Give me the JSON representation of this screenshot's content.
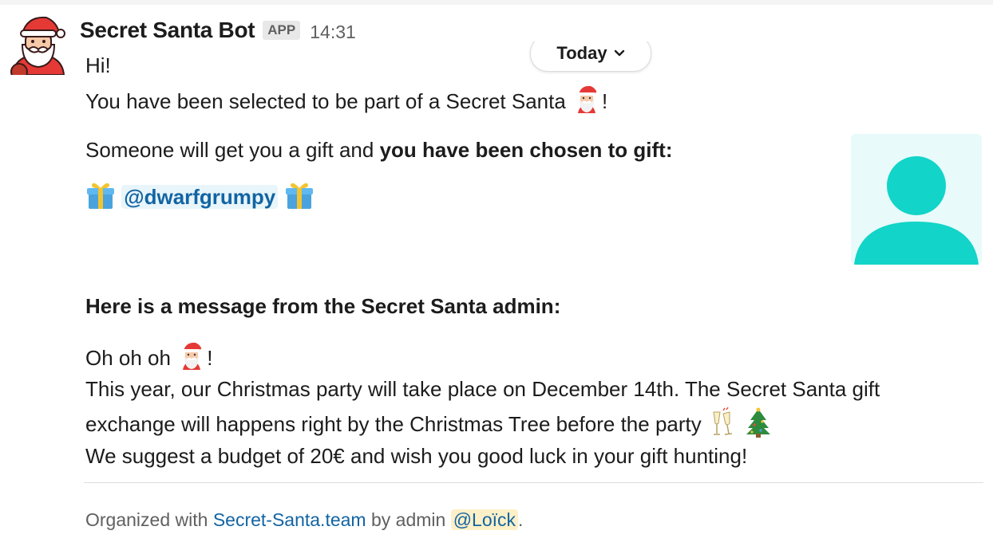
{
  "message": {
    "sender": "Secret Santa Bot",
    "badge": "APP",
    "time": "14:31",
    "date_divider": "Today",
    "greeting": "Hi!",
    "selected_text": "You have been selected to be part of a Secret Santa",
    "exclaim": "!",
    "gift_intro": "Someone will get you a gift and ",
    "gift_intro_bold": "you have been chosen to gift:",
    "recipient_mention": "@dwarfgrumpy",
    "admin_heading": "Here is a message from the Secret Santa admin:",
    "admin_greeting": "Oh oh oh",
    "admin_line1": "This year, our Christmas party will take place on December 14th. The Secret Santa gift",
    "admin_line2": "exchange will happens right by the Christmas Tree before the party",
    "admin_line3": "We suggest a budget of 20€ and wish you good luck in your gift hunting!"
  },
  "footer": {
    "prefix": "Organized with ",
    "link_text": "Secret-Santa.team",
    "middle": " by admin ",
    "admin_mention": "@Loïck",
    "suffix": "."
  },
  "icons": {
    "avatar": "santa-avatar-icon",
    "santa": "santa-emoji-icon",
    "gift": "gift-emoji-icon",
    "champagne": "champagne-emoji-icon",
    "tree": "christmas-tree-emoji-icon",
    "profile": "user-placeholder-icon",
    "chevron": "chevron-down-icon"
  },
  "colors": {
    "link": "#1264a3",
    "mention_bg": "#e8f5fa",
    "admin_mention_bg": "#fdf0c7",
    "profile_bg": "#e8fafa",
    "profile_fg": "#12d4c8",
    "santa_red": "#e53935"
  }
}
